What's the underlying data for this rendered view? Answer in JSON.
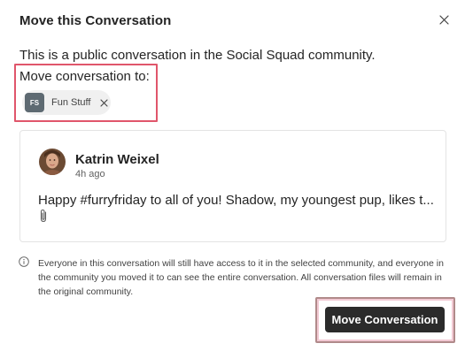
{
  "dialog": {
    "title": "Move this Conversation",
    "description": "This is a public conversation in the Social Squad community.",
    "move_to_label": "Move conversation to:",
    "selected_community": {
      "initials": "FS",
      "name": "Fun Stuff"
    }
  },
  "post": {
    "author": "Katrin Weixel",
    "time": "4h ago",
    "text": "Happy #furryfriday to all of you! Shadow, my youngest pup, likes t..."
  },
  "info": {
    "text": "Everyone in this conversation will still have access to it in the selected community, and everyone in the community you moved it to can see the entire conversation. All conversation files will remain in the original community."
  },
  "actions": {
    "move_button_label": "Move Conversation"
  },
  "colors": {
    "primary_button": "#2b2b2b",
    "highlight": "#e0566b",
    "chip_avatar": "#5e6a72"
  }
}
